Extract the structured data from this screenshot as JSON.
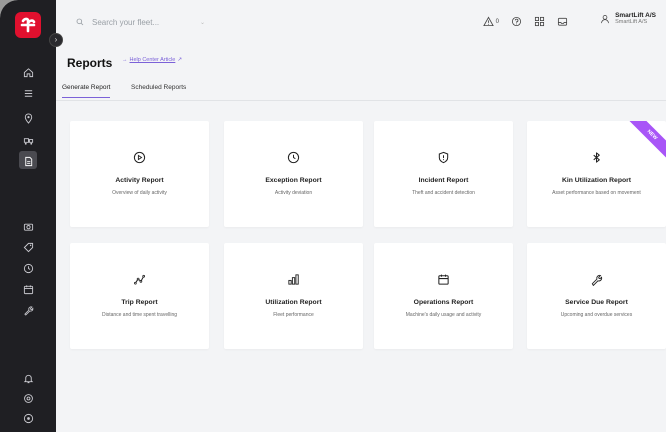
{
  "header": {
    "search_placeholder": "Search your fleet...",
    "alert_count": "0",
    "user_name": "SmartLift A/S",
    "user_org": "SmartLift A/S"
  },
  "page": {
    "title": "Reports",
    "help_link": "Help Center Article"
  },
  "tabs": [
    {
      "label": "Generate Report",
      "active": true
    },
    {
      "label": "Scheduled Reports",
      "active": false
    }
  ],
  "sidebar": {
    "icons": [
      "home-icon",
      "list-icon",
      "location-pin-icon",
      "units-icon",
      "reports-icon",
      "camera-icon",
      "tag-icon",
      "clock-icon",
      "calendar-icon",
      "wrench-icon",
      "bell-icon",
      "settings-icon",
      "help-icon"
    ]
  },
  "cards": [
    {
      "title": "Activity Report",
      "desc": "Overview of daily activity",
      "icon": "play-circle-icon"
    },
    {
      "title": "Exception Report",
      "desc": "Activity deviation",
      "icon": "clock-icon"
    },
    {
      "title": "Incident Report",
      "desc": "Theft and accident detection",
      "icon": "shield-alert-icon"
    },
    {
      "title": "Kin Utilization Report",
      "desc": "Asset performance based on movement",
      "icon": "bluetooth-icon",
      "badge": "NEW"
    },
    {
      "title": "Trip Report",
      "desc": "Distance and time spent travelling",
      "icon": "route-icon"
    },
    {
      "title": "Utilization Report",
      "desc": "Fleet performance",
      "icon": "bar-chart-icon"
    },
    {
      "title": "Operations Report",
      "desc": "Machine's daily usage and activity",
      "icon": "calendar-icon"
    },
    {
      "title": "Service Due Report",
      "desc": "Upcoming and overdue services",
      "icon": "wrench-icon"
    }
  ],
  "colors": {
    "accent": "#7b61d8",
    "sidebar_bg": "#1f1f23",
    "brand_red": "#e0102e",
    "badge": "#a855f7"
  }
}
